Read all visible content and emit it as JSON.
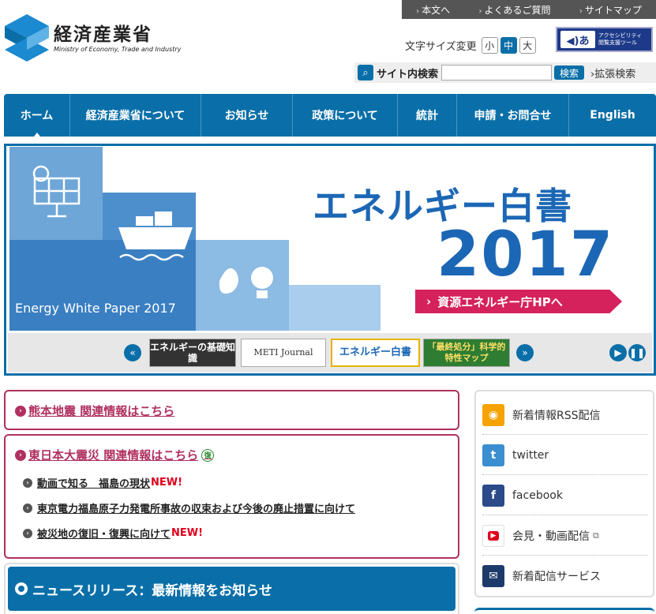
{
  "utility_nav": [
    {
      "label": "本文へ"
    },
    {
      "label": "よくあるご質問"
    },
    {
      "label": "サイトマップ"
    }
  ],
  "logo": {
    "ja": "経済産業省",
    "en": "Ministry of Economy, Trade and Industry"
  },
  "font_size": {
    "label": "文字サイズ変更",
    "small": "小",
    "medium": "中",
    "large": "大",
    "selected": "中"
  },
  "accessibility": {
    "icon_text": "◀)あ",
    "line1": "アクセシビリティ",
    "line2": "閲覧支援ツール"
  },
  "search": {
    "label": "サイト内検索",
    "placeholder": "",
    "button": "検索",
    "advanced": "拡張検索"
  },
  "main_nav": [
    {
      "label": "ホーム",
      "active": true
    },
    {
      "label": "経済産業省について"
    },
    {
      "label": "お知らせ"
    },
    {
      "label": "政策について"
    },
    {
      "label": "統計"
    },
    {
      "label": "申請・お問合せ"
    },
    {
      "label": "English"
    }
  ],
  "banner": {
    "title": "エネルギー白書",
    "year": "2017",
    "caption": "Energy White Paper 2017",
    "cta": "資源エネルギー庁HPへ",
    "thumbs": [
      {
        "label": "エネルギーの基礎知識"
      },
      {
        "label": "METI Journal"
      },
      {
        "label": "エネルギー白書"
      },
      {
        "label": "「最終処分」科学的特性マップ"
      }
    ]
  },
  "notices": {
    "kumamoto": "熊本地震 関連情報はこちら",
    "higashi": "東日本大震災 関連情報はこちら",
    "fukko_badge": "復",
    "items": [
      {
        "text": "動画で知る　福島の現状",
        "new": "NEW!"
      },
      {
        "text": "東京電力福島原子力発電所事故の収束および今後の廃止措置に向けて",
        "new": ""
      },
      {
        "text": "被災地の復旧・復興に向けて",
        "new": "NEW!"
      }
    ]
  },
  "news": {
    "heading": "ニュースリリース：最新情報をお知らせ"
  },
  "sidebar": [
    {
      "label": "新着情報RSS配信",
      "icon": "rss-icon",
      "color": "#f5a300"
    },
    {
      "label": "twitter",
      "icon": "twitter-icon",
      "color": "#3a8fd0"
    },
    {
      "label": "facebook",
      "icon": "facebook-icon",
      "color": "#2a4a8a"
    },
    {
      "label": "会見・動画配信",
      "icon": "youtube-icon",
      "color": "#e0001b"
    },
    {
      "label": "新着配信サービス",
      "icon": "mail-icon",
      "color": "#1d3a6a"
    }
  ],
  "colors": {
    "primary": "#0a6fa8",
    "accent": "#d5215c",
    "notice": "#b03060"
  }
}
